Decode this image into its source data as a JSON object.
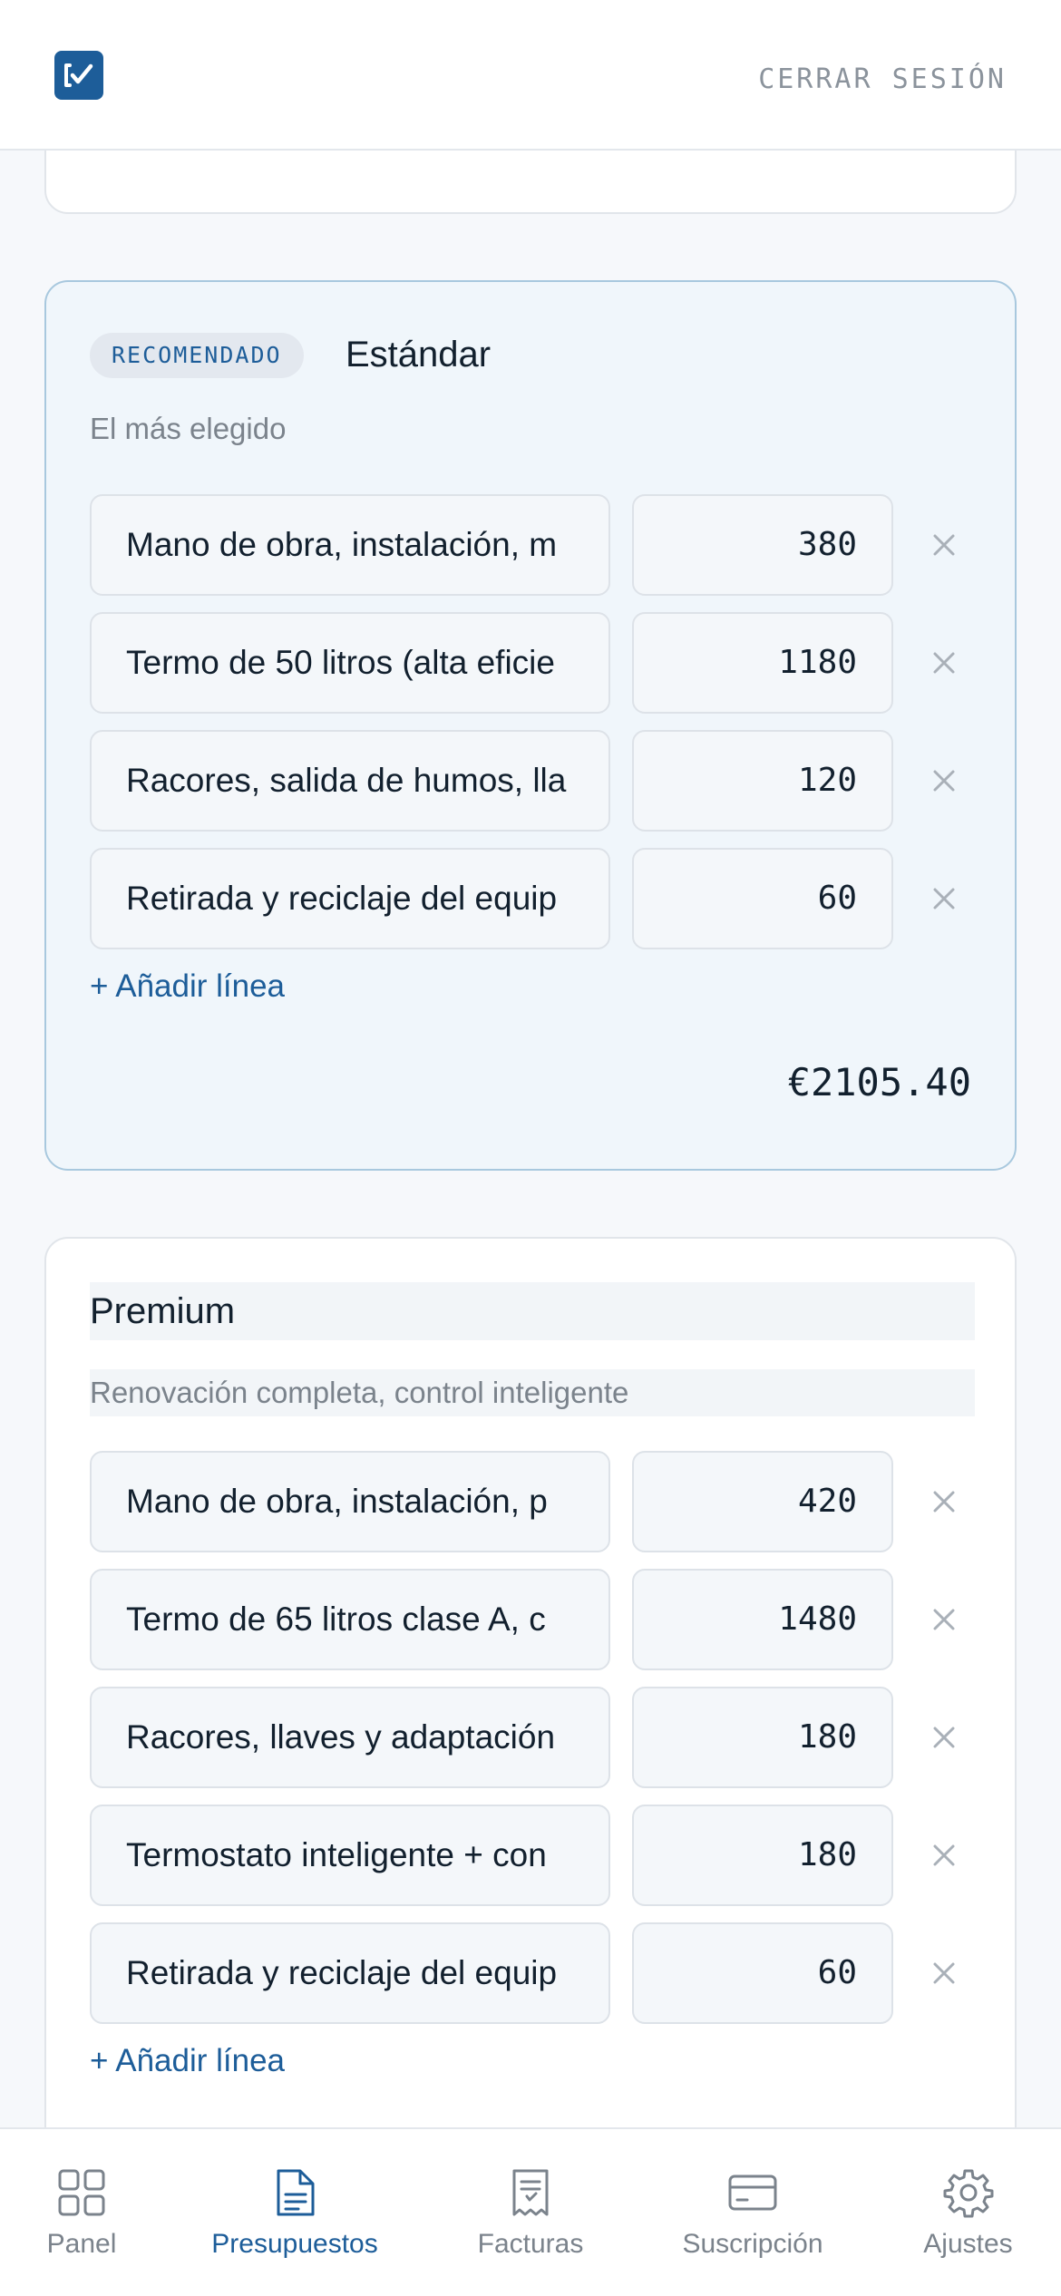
{
  "header": {
    "logout_label": "CERRAR SESIÓN"
  },
  "tiers": [
    {
      "badge": "RECOMENDADO",
      "title": "Estándar",
      "description": "El más elegido",
      "lines": [
        {
          "description": "Mano de obra, instalación, m",
          "amount": "380"
        },
        {
          "description": "Termo de 50 litros (alta eficie",
          "amount": "1180"
        },
        {
          "description": "Racores, salida de humos, lla",
          "amount": "120"
        },
        {
          "description": "Retirada y reciclaje del equip",
          "amount": "60"
        }
      ],
      "add_line_label": "+ Añadir línea",
      "total": "€2105.40"
    },
    {
      "title": "Premium",
      "description": "Renovación completa, control inteligente",
      "lines": [
        {
          "description": "Mano de obra, instalación, p",
          "amount": "420"
        },
        {
          "description": "Termo de 65 litros clase A, c",
          "amount": "1480"
        },
        {
          "description": "Racores, llaves y adaptación",
          "amount": "180"
        },
        {
          "description": "Termostato inteligente + con",
          "amount": "180"
        },
        {
          "description": "Retirada y reciclaje del equip",
          "amount": "60"
        }
      ],
      "add_line_label": "+ Añadir línea"
    }
  ],
  "bottom_nav": {
    "active": "Presupuestos",
    "items": [
      {
        "label": "Panel",
        "icon": "grid-icon"
      },
      {
        "label": "Presupuestos",
        "icon": "document-icon"
      },
      {
        "label": "Facturas",
        "icon": "receipt-icon"
      },
      {
        "label": "Suscripción",
        "icon": "credit-card-icon"
      },
      {
        "label": "Ajustes",
        "icon": "gear-icon"
      }
    ]
  },
  "colors": {
    "accent": "#1d5d99",
    "muted": "#7b838c",
    "recommended_bg": "#f0f6fb",
    "recommended_border": "#a8c8de"
  }
}
